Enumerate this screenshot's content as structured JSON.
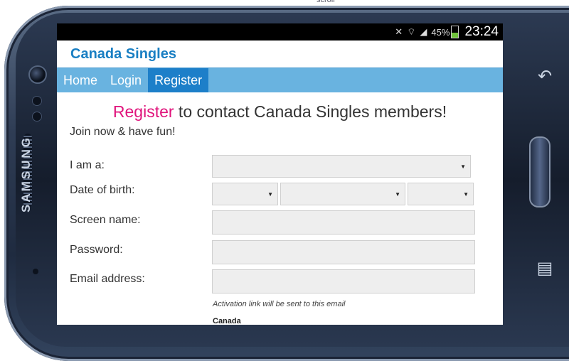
{
  "device": {
    "brand": "SAMSUNG",
    "top_label": "scroll"
  },
  "status_bar": {
    "battery_percent": "45%",
    "battery_level": 0.45,
    "time": "23:24"
  },
  "site": {
    "title": "Canada Singles"
  },
  "nav": {
    "items": [
      {
        "label": "Home"
      },
      {
        "label": "Login"
      },
      {
        "label": "Register",
        "active": true
      }
    ]
  },
  "page": {
    "headline_accent": "Register",
    "headline_rest": " to contact Canada Singles members!",
    "subline": "Join now & have fun!"
  },
  "form": {
    "i_am_label": "I am a:",
    "dob_label": "Date of birth:",
    "screen_name_label": "Screen name:",
    "password_label": "Password:",
    "email_label": "Email address:",
    "email_hint": "Activation link will be sent to this email",
    "country_label": "Canada"
  },
  "colors": {
    "accent": "#e0147c",
    "brand": "#1a7fc3",
    "nav_bg": "#69b3e0",
    "nav_active": "#1d7fc9"
  }
}
